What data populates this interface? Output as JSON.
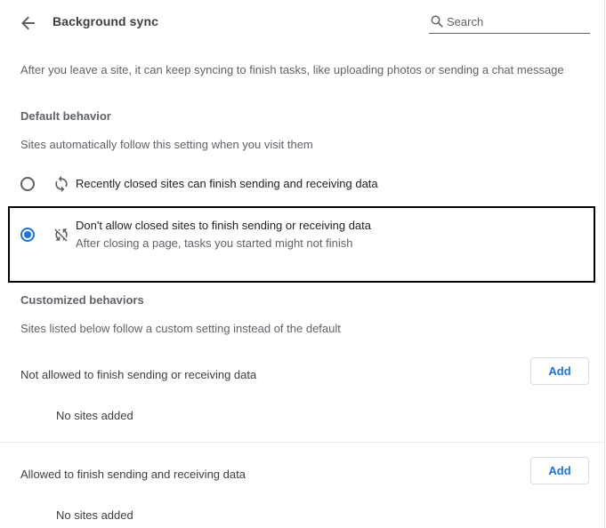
{
  "header": {
    "title": "Background sync",
    "back_icon": "arrow-back-icon",
    "search_placeholder": "Search",
    "search_value": ""
  },
  "description": "After you leave a site, it can keep syncing to finish tasks, like uploading photos or sending a chat message",
  "default_behavior": {
    "title": "Default behavior",
    "subtitle": "Sites automatically follow this setting when you visit them",
    "options": [
      {
        "label": "Recently closed sites can finish sending and receiving data",
        "sublabel": "",
        "icon": "sync-icon",
        "selected": false
      },
      {
        "label": "Don't allow closed sites to finish sending or receiving data",
        "sublabel": "After closing a page, tasks you started might not finish",
        "icon": "sync-disabled-icon",
        "selected": true
      }
    ]
  },
  "customized_behaviors": {
    "title": "Customized behaviors",
    "subtitle": "Sites listed below follow a custom setting instead of the default",
    "lists": [
      {
        "label": "Not allowed to finish sending or receiving data",
        "add_label": "Add",
        "empty_text": "No sites added"
      },
      {
        "label": "Allowed to finish sending and receiving data",
        "add_label": "Add",
        "empty_text": "No sites added"
      }
    ]
  },
  "colors": {
    "accent": "#1a73e8",
    "text_primary": "#202124",
    "text_secondary": "#5f6368",
    "highlight_border": "#000000"
  }
}
